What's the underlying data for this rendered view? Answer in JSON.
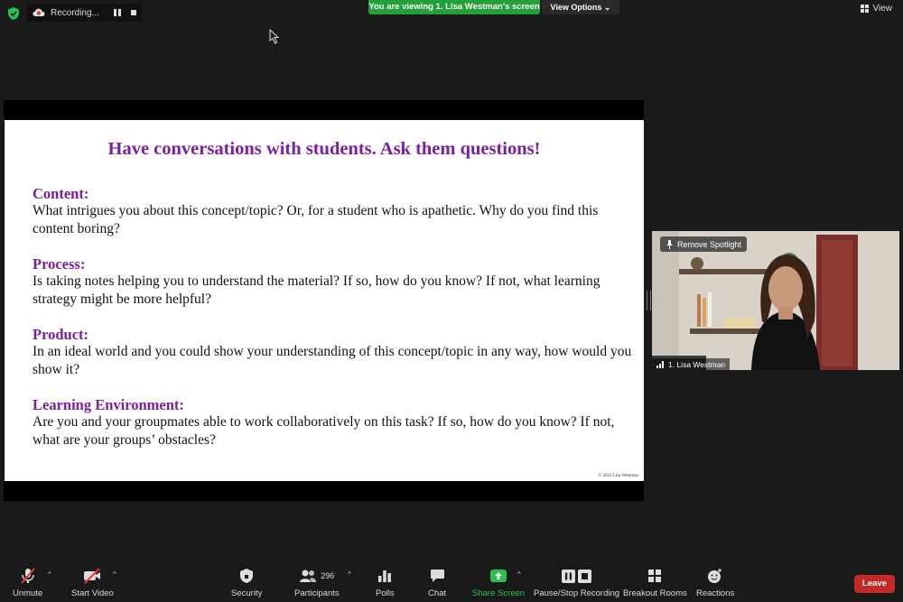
{
  "top": {
    "recording_label": "Recording...",
    "viewing_banner": "You are viewing 1. Lisa Westman's screen",
    "view_options_label": "View Options",
    "view_label": "View"
  },
  "slide": {
    "title": "Have conversations with students. Ask them questions!",
    "sections": [
      {
        "heading": "Content:",
        "body": "What intrigues you about this concept/topic? Or, for a student who is apathetic. Why do you find this content boring?"
      },
      {
        "heading": "Process:",
        "body": "Is taking notes helping you to understand the material? If so, how do you know? If not, what learning strategy might be more helpful?"
      },
      {
        "heading": "Product:",
        "body": "In an ideal world and you could show your understanding of this concept/topic in any way, how would you show it?"
      },
      {
        "heading": "Learning Environment:",
        "body": "Are you and your groupmates able to work collaboratively on this task? If so, how do you know? If not, what are your groups’ obstacles?"
      }
    ],
    "copyright": "© 2022 Lisa Westman"
  },
  "video": {
    "remove_spotlight_label": "Remove Spotlight",
    "participant_name": "1. Lisa Westman"
  },
  "toolbar": {
    "unmute": "Unmute",
    "start_video": "Start Video",
    "security": "Security",
    "participants": "Participants",
    "participants_count": "296",
    "polls": "Polls",
    "chat": "Chat",
    "share_screen": "Share Screen",
    "pause_stop_recording": "Pause/Stop Recording",
    "breakout_rooms": "Breakout Rooms",
    "reactions": "Reactions",
    "leave": "Leave"
  },
  "colors": {
    "background": "#1a1a1a",
    "banner_green": "#23a03a",
    "leave_red": "#c62828",
    "slide_purple": "#7b1fa2"
  }
}
